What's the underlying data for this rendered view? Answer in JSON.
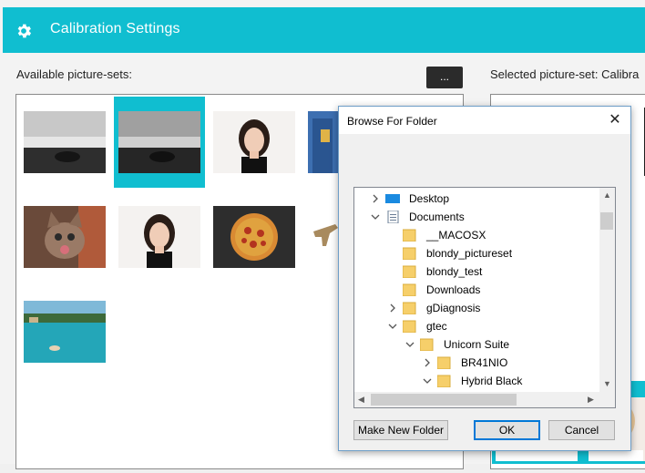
{
  "header": {
    "title": "Calibration Settings",
    "icon": "gear-icon",
    "color": "#10bed0"
  },
  "left_panel": {
    "label": "Available picture-sets:",
    "browse_label": "...",
    "thumbnails": [
      {
        "name": "bw-seascape-rock"
      },
      {
        "name": "bw-seascape-rock-selected",
        "selected": true
      },
      {
        "name": "woman-portrait-1"
      },
      {
        "name": "city-building"
      },
      {
        "name": "kitten"
      },
      {
        "name": "woman-portrait-2"
      },
      {
        "name": "pizza"
      },
      {
        "name": "dinosaur"
      },
      {
        "name": "tropical-lagoon"
      }
    ]
  },
  "right_panel": {
    "label": "Selected picture-set: Calibra"
  },
  "dialog": {
    "title": "Browse For Folder",
    "close_label": "✕",
    "tree": [
      {
        "label": "Desktop",
        "expand": "collapsed",
        "icon": "desktop"
      },
      {
        "label": "Documents",
        "expand": "expanded",
        "icon": "document"
      },
      {
        "label": "__MACOSX",
        "expand": "none",
        "icon": "folder"
      },
      {
        "label": "blondy_pictureset",
        "expand": "none",
        "icon": "folder"
      },
      {
        "label": "blondy_test",
        "expand": "none",
        "icon": "folder"
      },
      {
        "label": "Downloads",
        "expand": "none",
        "icon": "folder"
      },
      {
        "label": "gDiagnosis",
        "expand": "collapsed",
        "icon": "folder"
      },
      {
        "label": "gtec",
        "expand": "expanded",
        "icon": "folder"
      },
      {
        "label": "Unicorn Suite",
        "expand": "expanded",
        "icon": "folder"
      },
      {
        "label": "BR41NIO",
        "expand": "collapsed",
        "icon": "folder"
      },
      {
        "label": "Hybrid Black",
        "expand": "expanded",
        "icon": "folder"
      }
    ],
    "buttons": {
      "new_folder": "Make New Folder",
      "ok": "OK",
      "cancel": "Cancel"
    }
  }
}
